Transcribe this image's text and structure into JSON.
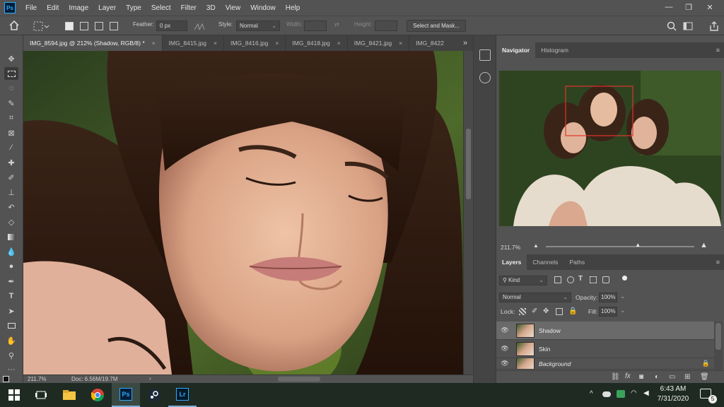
{
  "app": {
    "logo": "Ps",
    "accent": "#31a8ff"
  },
  "menu": [
    "File",
    "Edit",
    "Image",
    "Layer",
    "Type",
    "Select",
    "Filter",
    "3D",
    "View",
    "Window",
    "Help"
  ],
  "window_controls": {
    "minimize": "—",
    "restore": "❐",
    "close": "✕"
  },
  "options": {
    "feather_label": "Feather:",
    "feather_value": "0 px",
    "style_label": "Style:",
    "style_value": "Normal",
    "width_label": "Width:",
    "height_label": "Height:",
    "select_mask": "Select and Mask..."
  },
  "tabs": [
    {
      "label": "IMG_8594.jpg @ 212% (Shadow, RGB/8) *",
      "close": "×"
    },
    {
      "label": "IMG_8415.jpg",
      "close": "×"
    },
    {
      "label": "IMG_8416.jpg",
      "close": "×"
    },
    {
      "label": "IMG_8418.jpg",
      "close": "×"
    },
    {
      "label": "IMG_8421.jpg",
      "close": "×"
    },
    {
      "label": "IMG_8422",
      "close": ""
    }
  ],
  "tabs_overflow": "»",
  "tools": [
    "move-icon",
    "marquee-icon",
    "lasso-icon",
    "quick-select-icon",
    "crop-icon",
    "frame-icon",
    "eyedropper-icon",
    "healing-icon",
    "brush-icon",
    "stamp-icon",
    "history-brush-icon",
    "eraser-icon",
    "gradient-icon",
    "blur-icon",
    "dodge-icon",
    "pen-icon",
    "type-icon",
    "path-select-icon",
    "rectangle-icon",
    "hand-icon",
    "zoom-icon",
    "more-icon"
  ],
  "status": {
    "zoom": "211.7%",
    "doc": "Doc: 6.56M/19.7M",
    "arrow": "›"
  },
  "navigator": {
    "tabs": [
      "Navigator",
      "Histogram"
    ],
    "zoom": "211.7%",
    "zoom_level": 0.62
  },
  "layers_panel": {
    "tabs": [
      "Layers",
      "Channels",
      "Paths"
    ],
    "filter_kind": "Kind",
    "blend_mode": "Normal",
    "opacity_label": "Opacity:",
    "opacity_value": "100%",
    "lock_label": "Lock:",
    "fill_label": "Fill:",
    "fill_value": "100%",
    "layers": [
      {
        "name": "Shadow",
        "selected": true
      },
      {
        "name": "Skin",
        "selected": false
      },
      {
        "name": "Background",
        "selected": false
      }
    ],
    "footer_icons": [
      "link-icon",
      "fx-icon",
      "mask-icon",
      "adjustment-icon",
      "group-icon",
      "new-layer-icon",
      "trash-icon"
    ]
  },
  "taskbar": {
    "apps": [
      "windows-icon",
      "task-view-icon",
      "file-explorer-icon",
      "chrome-icon",
      "photoshop-icon",
      "steam-icon",
      "lightroom-icon"
    ],
    "ps_label": "Ps",
    "lr_label": "Lr",
    "time": "6:43 AM",
    "date": "7/31/2020",
    "notification_count": "5"
  }
}
